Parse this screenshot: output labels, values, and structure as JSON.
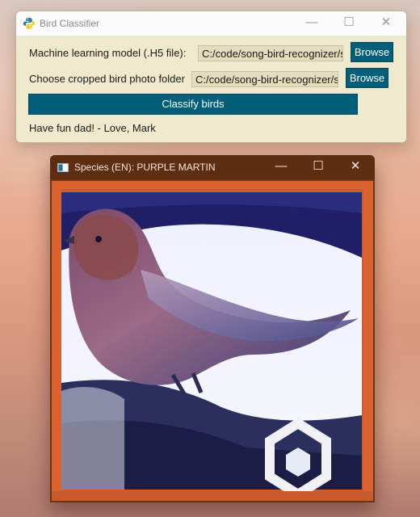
{
  "main_window": {
    "title": "Bird Classifier",
    "minimize": "—",
    "maximize": "☐",
    "close": "✕",
    "model_label": "Machine learning model (.H5 file):",
    "model_path": "C:/code/song-bird-recognizer/s",
    "browse_label": "Browse",
    "folder_label": "Choose cropped bird photo folder",
    "folder_path": "C:/code/song-bird-recognizer/s",
    "classify_label": "Classify birds",
    "footer_note": "Have fun dad! - Love, Mark"
  },
  "species_window": {
    "title": "Species (EN): PURPLE MARTIN",
    "minimize": "—",
    "maximize": "☐",
    "close": "✕",
    "photo_icon": "bird-photo"
  },
  "colors": {
    "button": "#005e79",
    "window_bg": "#efeacd",
    "photo_border": "#d9622e"
  }
}
